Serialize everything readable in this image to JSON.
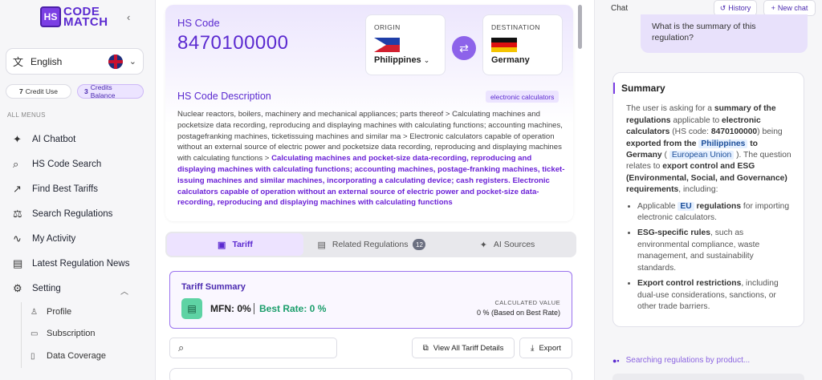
{
  "brand": {
    "mark": "HS",
    "line1": "CODE",
    "line2": "MATCH"
  },
  "sidebar": {
    "language": "English",
    "credit_use": {
      "count": "7",
      "label": "Credit Use"
    },
    "credit_balance": {
      "count": "3",
      "label": "Credits Balance"
    },
    "menu_title": "ALL MENUS",
    "items": [
      {
        "label": "AI Chatbot"
      },
      {
        "label": "HS Code Search"
      },
      {
        "label": "Find Best Tariffs"
      },
      {
        "label": "Search Regulations"
      },
      {
        "label": "My Activity"
      },
      {
        "label": "Latest Regulation News"
      },
      {
        "label": "Setting"
      }
    ],
    "subitems": [
      {
        "label": "Profile"
      },
      {
        "label": "Subscription"
      },
      {
        "label": "Data Coverage"
      }
    ]
  },
  "hs": {
    "label": "HS Code",
    "code": "8470100000",
    "origin_label": "ORIGIN",
    "origin": "Philippines",
    "destination_label": "DESTINATION",
    "destination": "Germany",
    "desc_title": "HS Code Description",
    "tag": "electronic calculators",
    "desc_plain": "Nuclear reactors, boilers, machinery and mechanical appliances; parts thereof  >  Calculating machines and pocketsize data recording, reproducing and displaying machines with calculating functions; accounting machines, postagefranking machines, ticketissuing machines and similar ma  >  Electronic calculators capable of operation without an external source of electric power and pocketsize data recording, reproducing and displaying machines with calculating functions  >  ",
    "desc_highlight": "Calculating machines and pocket-size data-recording, reproducing and displaying machines with calculating functions; accounting machines, postage-franking machines, ticket-issuing machines and similar machines, incorporating a calculating device; cash registers. Electronic calculators capable of operation without an external source of electric power and pocket-size data-recording, reproducing and displaying machines with calculating functions"
  },
  "tabs": [
    {
      "label": "Tariff"
    },
    {
      "label": "Related Regulations",
      "badge": "12"
    },
    {
      "label": "AI Sources"
    }
  ],
  "tariff": {
    "title": "Tariff Summary",
    "mfn": "MFN: 0%",
    "best": "Best Rate: 0 %",
    "calc_label": "CALCULATED VALUE",
    "calc_value": "0 % (Based on Best Rate)"
  },
  "toolbar": {
    "search_placeholder": "",
    "view_all": "View All Tariff Details",
    "export": "Export"
  },
  "chat": {
    "title": "Chat",
    "history": "History",
    "new_chat": "New chat",
    "user_message": "What is the summary of this regulation?",
    "answer_title": "Summary",
    "searching": "Searching regulations by product..."
  },
  "colors": {
    "accent": "#5b2ad0",
    "accent_light": "#ece4ff",
    "success": "#1b9e6b"
  }
}
